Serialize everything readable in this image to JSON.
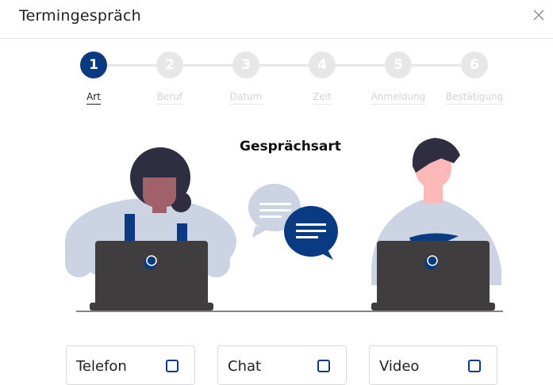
{
  "dialog": {
    "title": "Termingespräch",
    "close_icon": "close-icon"
  },
  "steps": [
    {
      "number": "1",
      "label": "Art",
      "active": true
    },
    {
      "number": "2",
      "label": "Beruf",
      "active": false
    },
    {
      "number": "3",
      "label": "Datum",
      "active": false
    },
    {
      "number": "4",
      "label": "Zeit",
      "active": false
    },
    {
      "number": "5",
      "label": "Anmeldung",
      "active": false
    },
    {
      "number": "6",
      "label": "Bestätigung",
      "active": false
    }
  ],
  "section": {
    "title": "Gesprächsart"
  },
  "options": [
    {
      "label": "Telefon",
      "checked": false
    },
    {
      "label": "Chat",
      "checked": false
    },
    {
      "label": "Video",
      "checked": false
    }
  ],
  "colors": {
    "accent": "#0a3a82",
    "inactive_step": "#e7e7e7",
    "laptop": "#3f3d3d",
    "shirt": "#ccd3e2"
  }
}
